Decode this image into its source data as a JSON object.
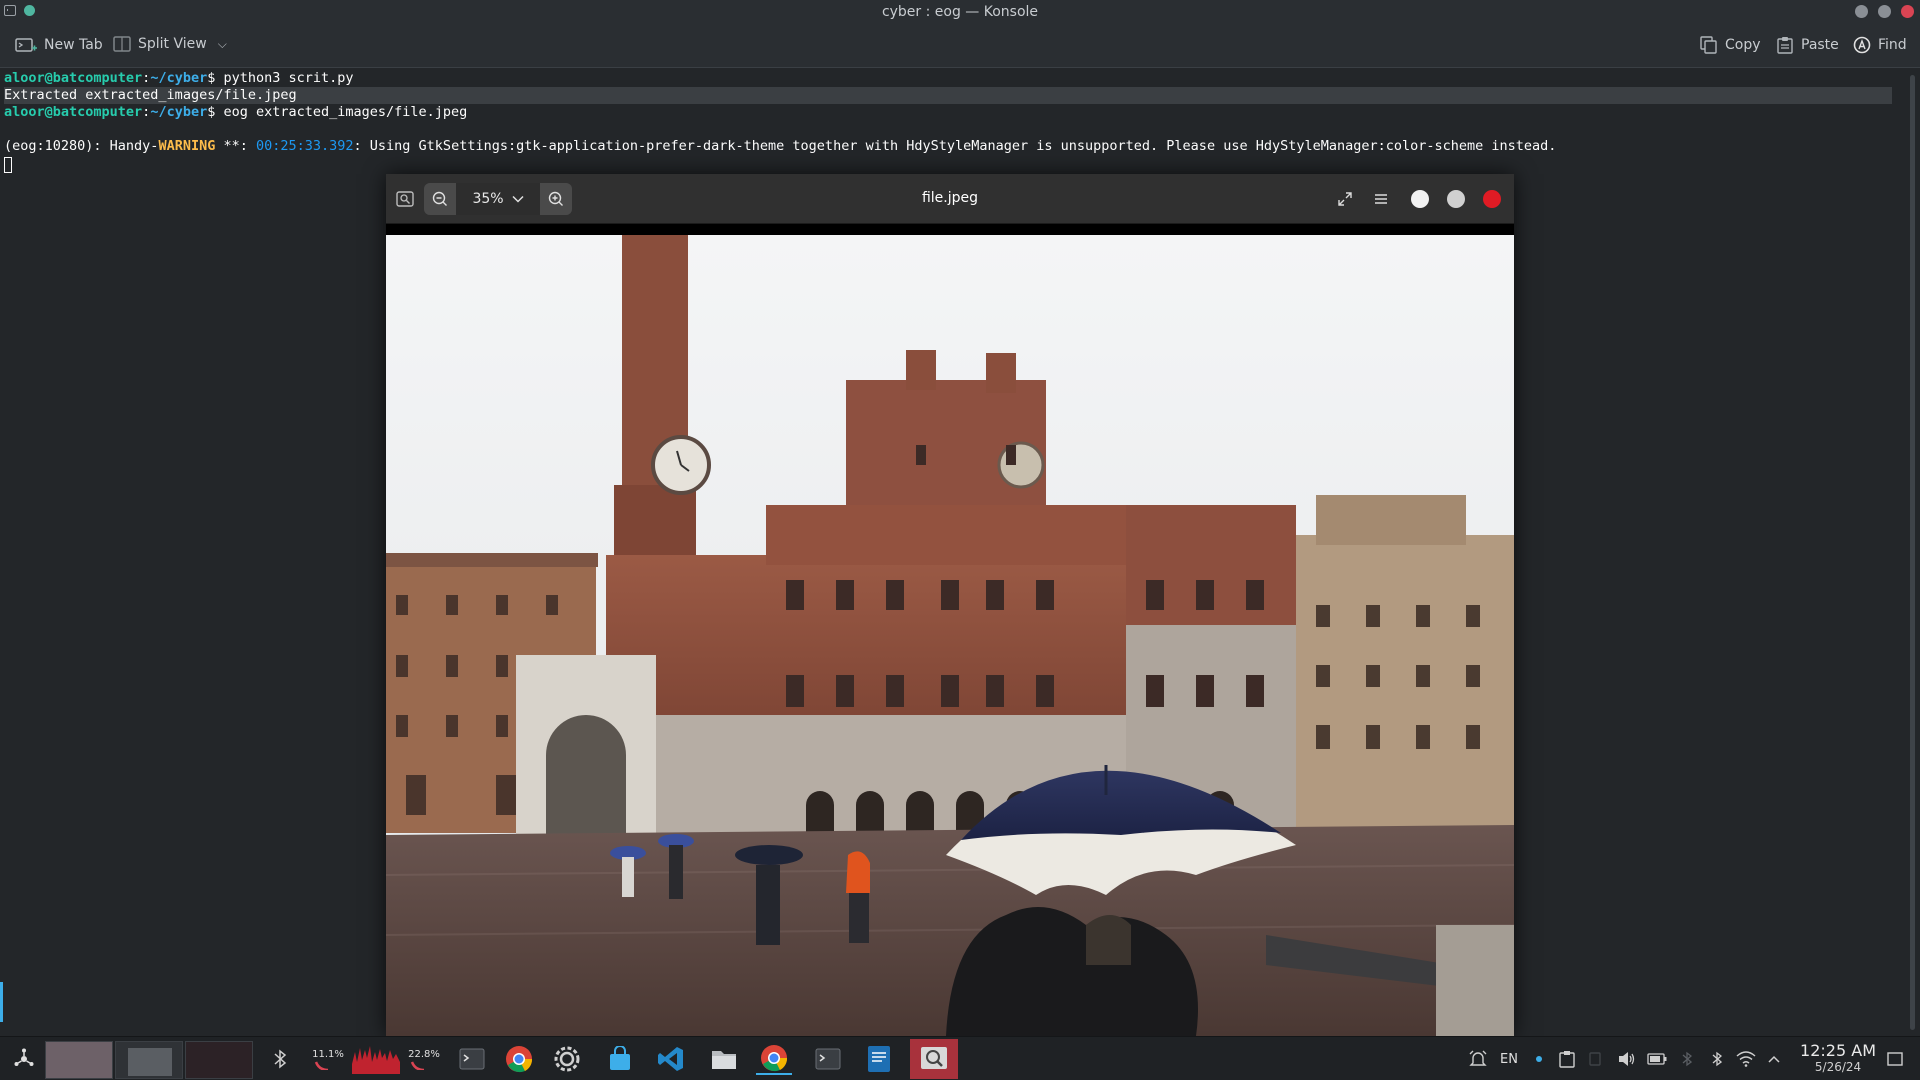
{
  "window": {
    "title": "cyber : eog — Konsole"
  },
  "toolbar": {
    "new_tab": "New Tab",
    "split_view": "Split View",
    "copy": "Copy",
    "paste": "Paste",
    "find": "Find"
  },
  "terminal": {
    "line1": {
      "user": "aloor@batcomputer",
      "sep": ":",
      "path": "~/cyber",
      "dollar": "$ ",
      "cmd": "python3 scrit.py"
    },
    "line2": {
      "prefix": "Extracted ",
      "file": "extracted_images/file.jpeg"
    },
    "line3": {
      "user": "aloor@batcomputer",
      "sep": ":",
      "path": "~/cyber",
      "dollar": "$ ",
      "cmd": "eog extracted_images/file.jpeg"
    },
    "line4": {
      "pre": "(eog:10280): Handy-",
      "warn": "WARNING",
      "mid": " **: ",
      "ts": "00:25:33.392",
      "msg": ": Using GtkSettings:gtk-application-prefer-dark-theme together with HdyStyleManager is unsupported. Please use HdyStyleManager:color-scheme instead."
    }
  },
  "eog": {
    "title": "file.jpeg",
    "zoom": "35%",
    "icons": [
      "gallery-icon",
      "zoom-out-icon",
      "chevron-down-icon",
      "zoom-in-icon",
      "fullscreen-icon",
      "hamburger-menu-icon",
      "minimize-icon",
      "maximize-icon",
      "close-icon"
    ]
  },
  "taskbar": {
    "cpu": "11.1%",
    "mem": "22.8%",
    "lang": "EN",
    "time": "12:25 AM",
    "date": "5/26/24"
  },
  "colors": {
    "terminal_bg": "#232629",
    "prompt_user": "#27ccad",
    "prompt_path": "#3daee9",
    "warning": "#fdbc4b",
    "timestamp": "#1d99f3",
    "close_red": "#e01b24"
  }
}
